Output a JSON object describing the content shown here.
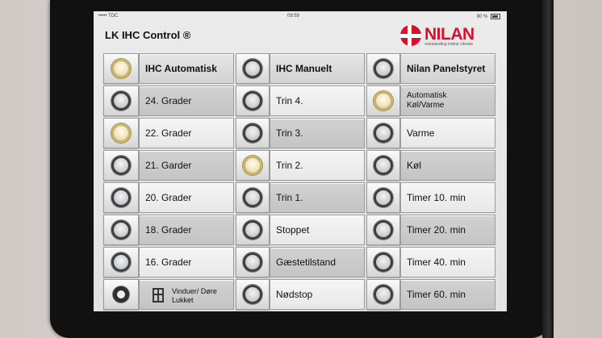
{
  "status_bar": {
    "carrier": "••••• TDC",
    "time": "09:59",
    "battery": "90 %"
  },
  "app_title": "LK IHC Control ®",
  "logo": {
    "name": "NILAN",
    "tagline": "•outstanding indoor climate"
  },
  "columns": [
    {
      "header": {
        "label": "IHC Automatisk",
        "active": true
      },
      "items": [
        {
          "label": "24. Grader",
          "active": false
        },
        {
          "label": "22. Grader",
          "active": true
        },
        {
          "label": "21. Garder",
          "active": false
        },
        {
          "label": "20. Grader",
          "active": false
        },
        {
          "label": "18. Grader",
          "active": false
        },
        {
          "label": "16. Grader",
          "active": false
        },
        {
          "label": "Vinduer/ Døre Lukket",
          "line1": "Vinduer/ Døre",
          "line2": "Lukket",
          "active": false
        }
      ]
    },
    {
      "header": {
        "label": "IHC Manuelt",
        "active": false
      },
      "items": [
        {
          "label": "Trin 4.",
          "active": false
        },
        {
          "label": "Trin 3.",
          "active": false
        },
        {
          "label": "Trin 2.",
          "active": true
        },
        {
          "label": "Trin 1.",
          "active": false
        },
        {
          "label": "Stoppet",
          "active": false
        },
        {
          "label": "Gæstetilstand",
          "active": false
        },
        {
          "label": "Nødstop",
          "active": false
        }
      ]
    },
    {
      "header": {
        "label": "Nilan Panelstyret",
        "active": false
      },
      "items": [
        {
          "label": "Automatisk Køl/Varme",
          "line1": "Automatisk",
          "line2": "Køl/Varme",
          "active": true
        },
        {
          "label": "Varme",
          "active": false
        },
        {
          "label": "Køl",
          "active": false
        },
        {
          "label": "Timer 10. min",
          "active": false
        },
        {
          "label": "Timer 20. min",
          "active": false
        },
        {
          "label": "Timer 40. min",
          "active": false
        },
        {
          "label": "Timer 60. min",
          "active": false
        }
      ]
    }
  ],
  "colors": {
    "accent_red": "#d7102b",
    "lamp_on": "#c9b56a",
    "lamp_off": "#3a3f44"
  }
}
